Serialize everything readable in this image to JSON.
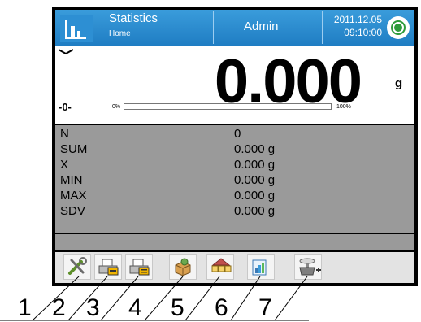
{
  "header": {
    "title": "Statistics",
    "subtitle": "Home",
    "user": "Admin",
    "date": "2011.12.05",
    "time": "09:10:00"
  },
  "weighing": {
    "reading": "0.000",
    "unit": "g",
    "zero_indicator": "-0-",
    "bar_min_label": "0%",
    "bar_max_label": "100%",
    "bar_fill_fraction": 0.0
  },
  "statistics": [
    {
      "name": "N",
      "value": "0"
    },
    {
      "name": "SUM",
      "value": "0.000 g"
    },
    {
      "name": "X",
      "value": "0.000 g"
    },
    {
      "name": "MIN",
      "value": "0.000 g"
    },
    {
      "name": "MAX",
      "value": "0.000 g"
    },
    {
      "name": "SDV",
      "value": "0.000 g"
    }
  ],
  "softkeys": [
    {
      "icon": "tools-icon"
    },
    {
      "icon": "print-icon"
    },
    {
      "icon": "print-report-icon"
    },
    {
      "icon": "product-box-icon"
    },
    {
      "icon": "product-database-icon"
    },
    {
      "icon": "chart-icon"
    },
    {
      "icon": "scale-add-icon"
    }
  ],
  "legend_numbers": [
    "1",
    "2",
    "3",
    "4",
    "5",
    "6",
    "7"
  ],
  "colors": {
    "header_blue": "#1f7dc3",
    "status_green": "#2e9b3a",
    "stats_gray": "#9a9a9a"
  }
}
